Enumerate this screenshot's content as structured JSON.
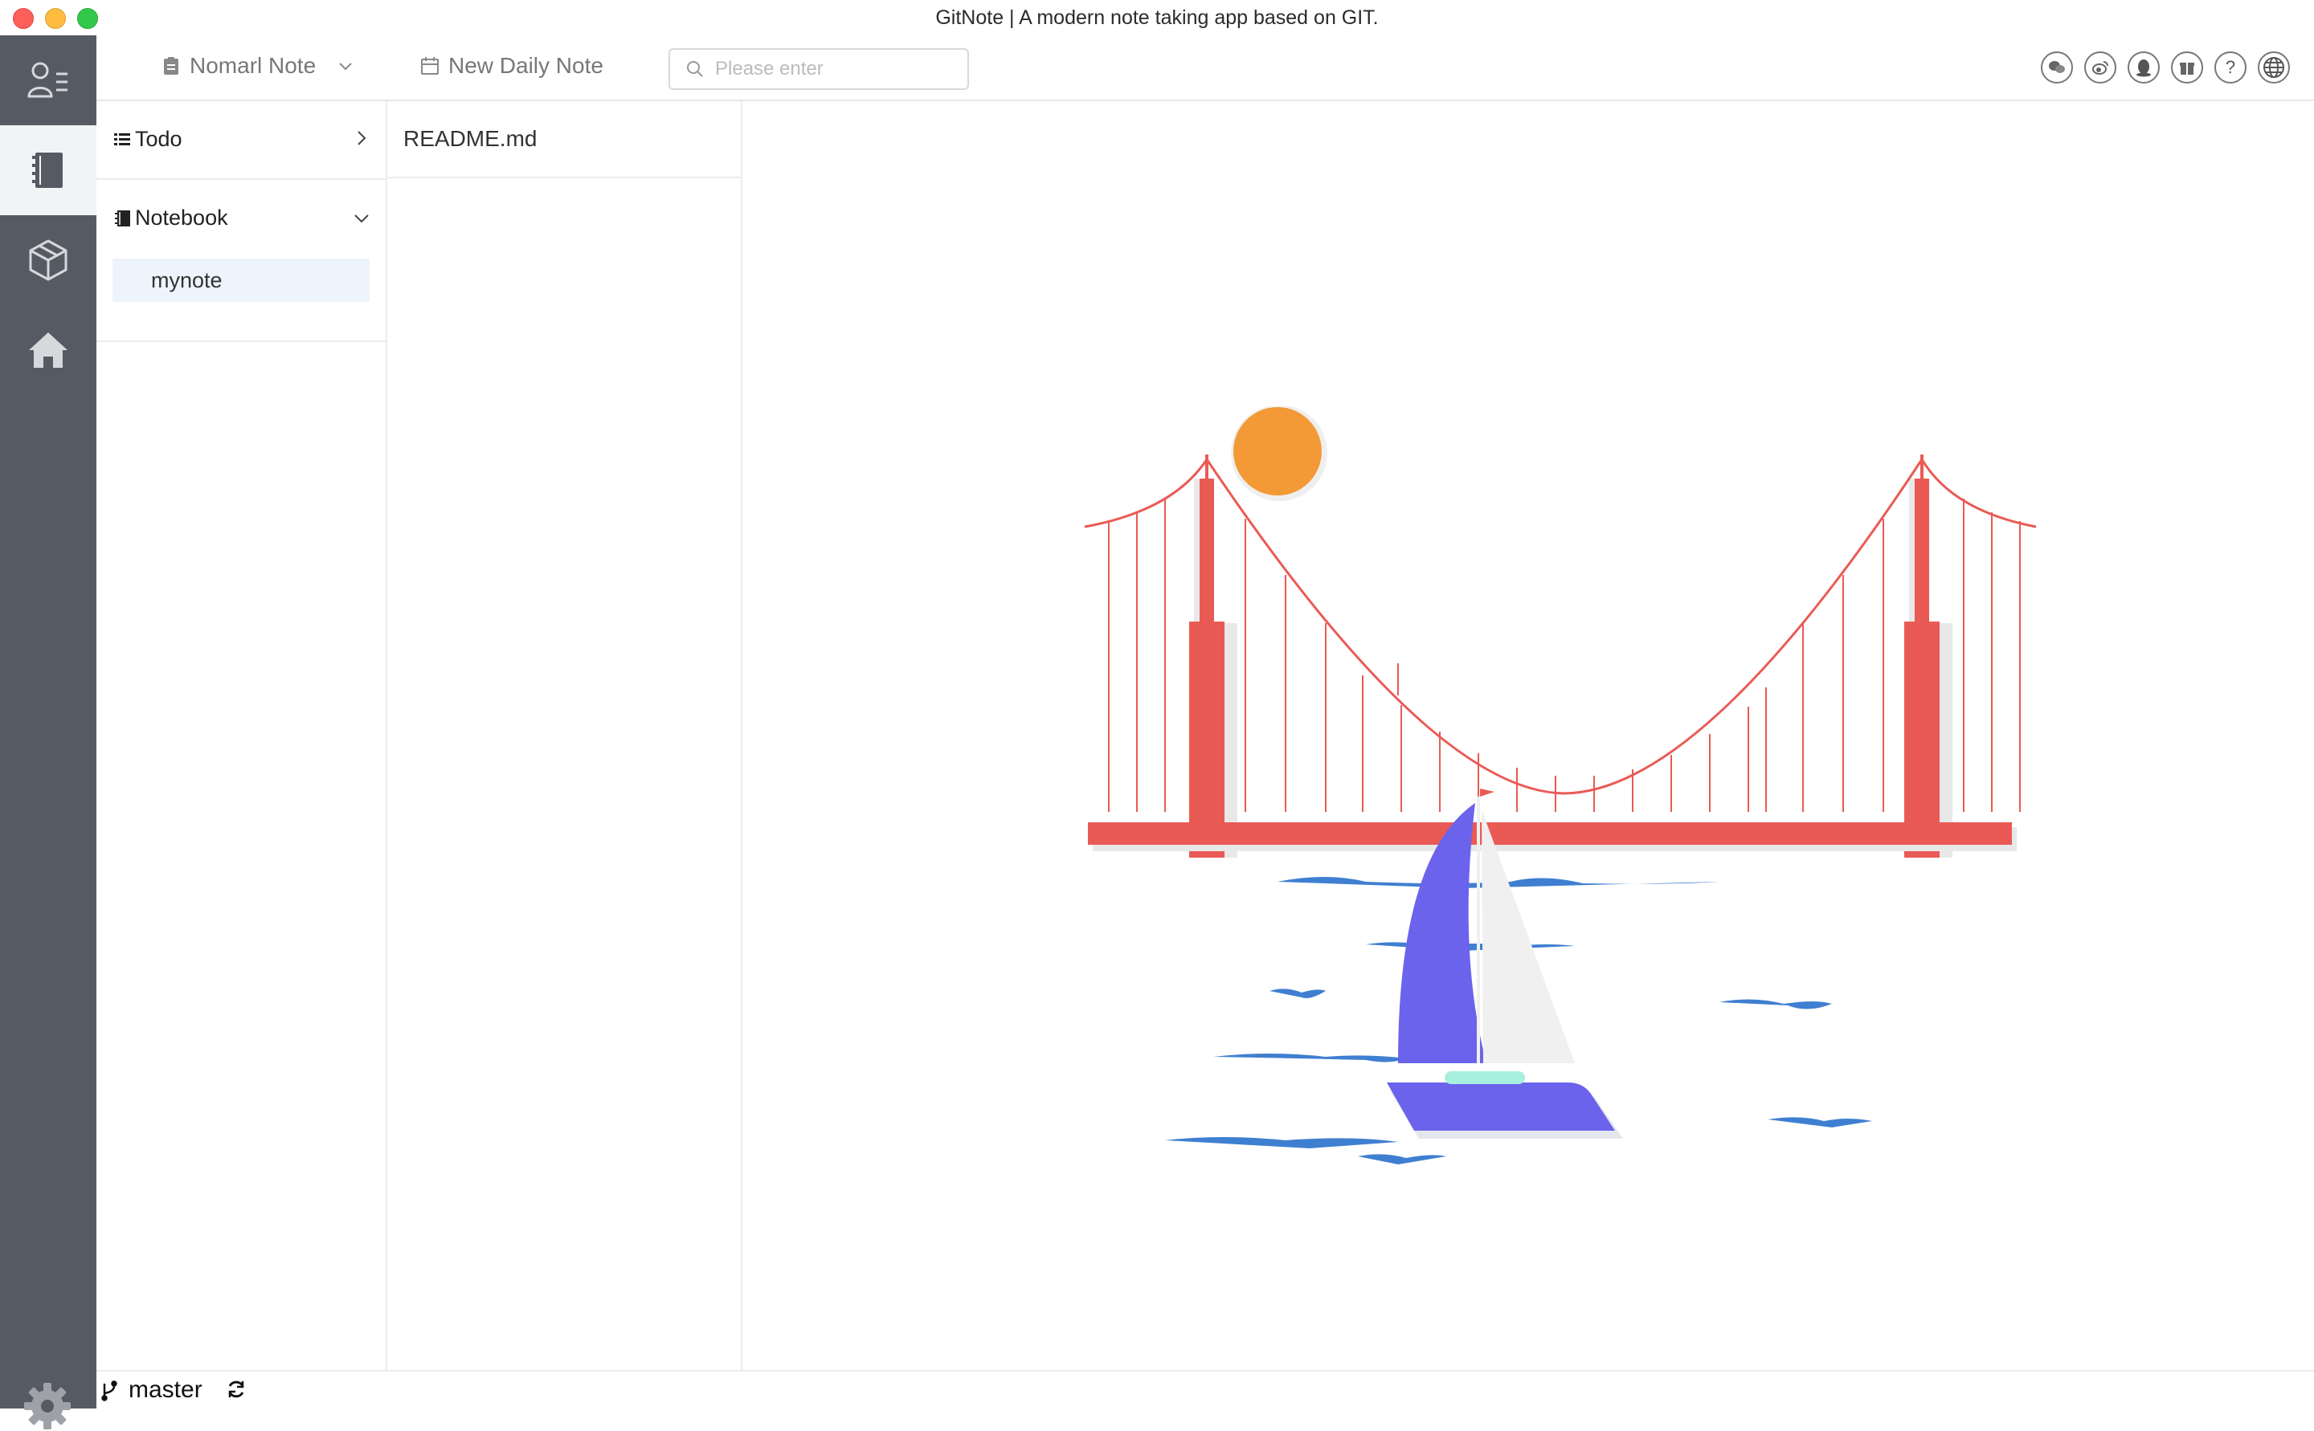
{
  "window": {
    "title": "GitNote | A modern note taking app based on GIT."
  },
  "rail": {
    "items": [
      {
        "icon": "user-list-icon",
        "label": "Profile"
      },
      {
        "icon": "notebook-icon",
        "label": "Notes",
        "active": true
      },
      {
        "icon": "cube-icon",
        "label": "Repository"
      },
      {
        "icon": "home-icon",
        "label": "Home"
      }
    ],
    "settings_icon": "gear-icon"
  },
  "toolbar": {
    "note_type": "Nomarl Note",
    "daily_note": "New Daily Note",
    "search_placeholder": "Please enter",
    "social_icons": [
      "wechat-icon",
      "weibo-icon",
      "qq-icon",
      "gift-icon",
      "help-icon",
      "globe-icon"
    ]
  },
  "sidebar": {
    "todo": {
      "label": "Todo",
      "expanded": false
    },
    "notebook": {
      "label": "Notebook",
      "expanded": true,
      "items": [
        "mynote"
      ]
    }
  },
  "files": [
    {
      "name": "README.md"
    }
  ],
  "status": {
    "branch": "master"
  },
  "colors": {
    "rail": "#565b63",
    "bridge": "#ea5a55",
    "sun": "#f39a37",
    "sail": "#6b63ec",
    "water": "#3f7fd1"
  }
}
